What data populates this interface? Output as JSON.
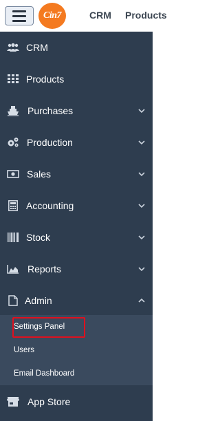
{
  "header": {
    "logo_text": "Cin7",
    "nav": [
      {
        "label": "CRM"
      },
      {
        "label": "Products"
      }
    ]
  },
  "sidebar": {
    "items": [
      {
        "label": "CRM",
        "icon": "users-icon",
        "has_chevron": false
      },
      {
        "label": "Products",
        "icon": "grid-icon",
        "has_chevron": false
      },
      {
        "label": "Purchases",
        "icon": "ship-icon",
        "has_chevron": true
      },
      {
        "label": "Production",
        "icon": "gears-icon",
        "has_chevron": true
      },
      {
        "label": "Sales",
        "icon": "money-icon",
        "has_chevron": true
      },
      {
        "label": "Accounting",
        "icon": "calculator-icon",
        "has_chevron": true
      },
      {
        "label": "Stock",
        "icon": "barcode-icon",
        "has_chevron": true
      },
      {
        "label": "Reports",
        "icon": "area-chart-icon",
        "has_chevron": true
      },
      {
        "label": "Admin",
        "icon": "file-icon",
        "has_chevron": true,
        "expanded": true
      }
    ],
    "admin_submenu": [
      {
        "label": "Settings Panel",
        "highlighted": true
      },
      {
        "label": "Users"
      },
      {
        "label": "Email Dashboard"
      }
    ],
    "app_store": {
      "label": "App Store",
      "icon": "store-icon"
    }
  },
  "colors": {
    "sidebar_bg": "#2e3d4f",
    "submenu_bg": "#3a4a5e",
    "logo": "#f47a20",
    "highlight_border": "#e0101e"
  }
}
